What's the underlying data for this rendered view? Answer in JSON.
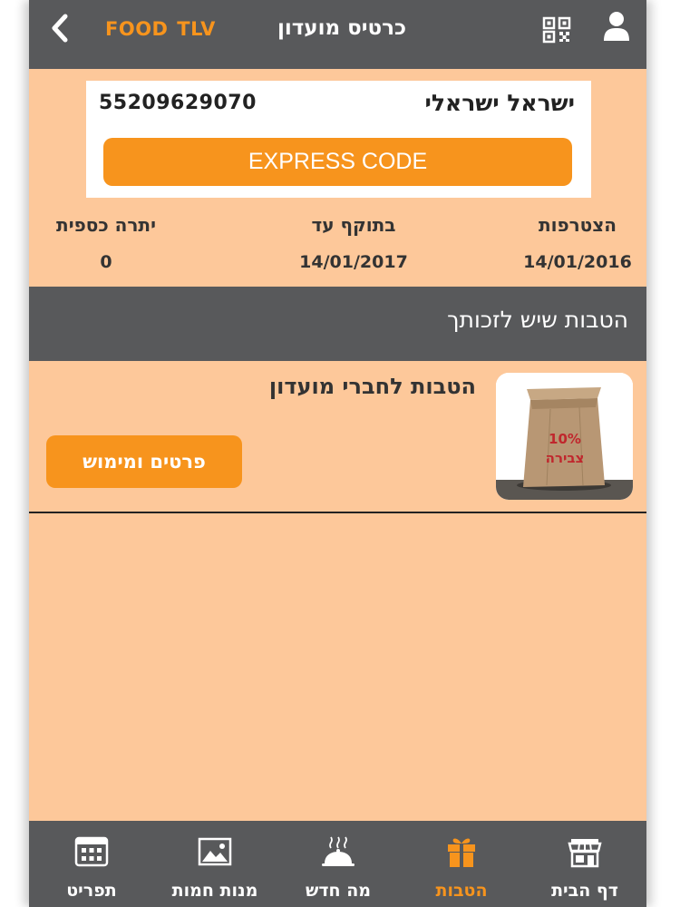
{
  "header": {
    "logo_part1": "FOOD",
    "logo_part2": "TLV",
    "title": "כרטיס מועדון",
    "back_icon": "chevron-left-icon",
    "qr_icon": "qr-code-icon",
    "user_icon": "user-icon"
  },
  "card": {
    "name": "ישראל ישראלי",
    "number": "55209629070",
    "express_label": "EXPRESS CODE"
  },
  "info": {
    "joined_label": "הצטרפות",
    "joined_value": "14/01/2016",
    "valid_label": "בתוקף עד",
    "valid_value": "14/01/2017",
    "balance_label": "יתרה כספית",
    "balance_value": "0"
  },
  "section": {
    "title": "הטבות שיש לזכותך"
  },
  "benefit": {
    "title": "הטבות לחברי מועדון",
    "button_label": "פרטים ומימוש",
    "bag_text_1": "10%",
    "bag_text_2": "צבירה"
  },
  "nav": {
    "items": [
      {
        "label": "דף הבית",
        "icon": "storefront-icon"
      },
      {
        "label": "הטבות",
        "icon": "gift-icon"
      },
      {
        "label": "מה חדש",
        "icon": "serving-dish-icon"
      },
      {
        "label": "מנות חמות",
        "icon": "image-icon"
      },
      {
        "label": "תפריט",
        "icon": "calendar-menu-icon"
      }
    ],
    "active_index": 1
  },
  "colors": {
    "accent": "#f7941d",
    "bar": "#58595b",
    "background": "#fdc89a"
  }
}
